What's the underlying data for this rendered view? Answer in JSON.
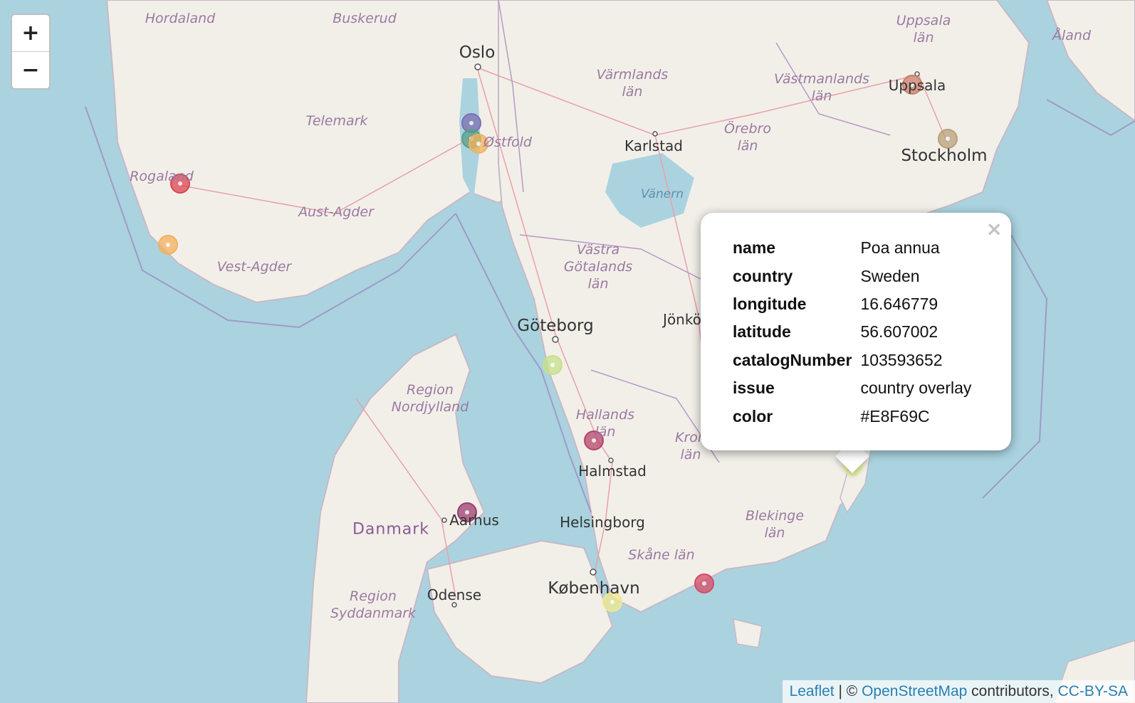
{
  "map": {
    "labels": {
      "hordaland": "Hordaland",
      "buskerud": "Buskerud",
      "oslo": "Oslo",
      "varmlands": "Värmlands\nlän",
      "uppsala_lan": "Uppsala\nlän",
      "aland": "Åland",
      "vastmanlands": "Västmanlands\nlän",
      "uppsala": "Uppsala",
      "telemark": "Telemark",
      "ostfold": "Østfold",
      "orebro": "Örebro\nlän",
      "karlstad": "Karlstad",
      "stockholm": "Stockholm",
      "rogaland": "Rogaland",
      "vanern": "Vänern",
      "aust_agder": "Aust-Agder",
      "vast_agder": "Vest-Agder",
      "vastra_gotalands": "Västra\nGötalands\nlän",
      "goteborg": "Göteborg",
      "jonkoping": "Jönkö",
      "region_nordjylland": "Region\nNordjylland",
      "hallands": "Hallands\nlän",
      "halmstad": "Halmstad",
      "kronobergs": "Kron\nlän",
      "danmark": "Danmark",
      "aarhus": "Aarhus",
      "helsingborg": "Helsingborg",
      "blekinge": "Blekinge\nlän",
      "skane": "Skåne län",
      "kobenhavn": "København",
      "region_syddanmark": "Region\nSyddanmark",
      "odense": "Odense"
    },
    "markers_colors": [
      "#7B6FB3",
      "#5B9E86",
      "#F2B25C",
      "#D9454F",
      "#F2B25C",
      "#C9806A",
      "#B9A07A",
      "#C7E08A",
      "#B5446B",
      "#9E3D6F",
      "#E8F69C",
      "#F1E88C",
      "#D54B66"
    ]
  },
  "zoom": {
    "in_label": "+",
    "out_label": "−"
  },
  "popup": {
    "close_label": "×",
    "rows": [
      {
        "key": "name",
        "value": "Poa annua"
      },
      {
        "key": "country",
        "value": "Sweden"
      },
      {
        "key": "longitude",
        "value": "16.646779"
      },
      {
        "key": "latitude",
        "value": "56.607002"
      },
      {
        "key": "catalogNumber",
        "value": "103593652"
      },
      {
        "key": "issue",
        "value": "country overlay"
      },
      {
        "key": "color",
        "value": "#E8F69C"
      }
    ]
  },
  "attribution": {
    "leaflet": "Leaflet",
    "separator": " | © ",
    "osm": "OpenStreetMap",
    "contributors": " contributors, ",
    "license": "CC-BY-SA"
  }
}
